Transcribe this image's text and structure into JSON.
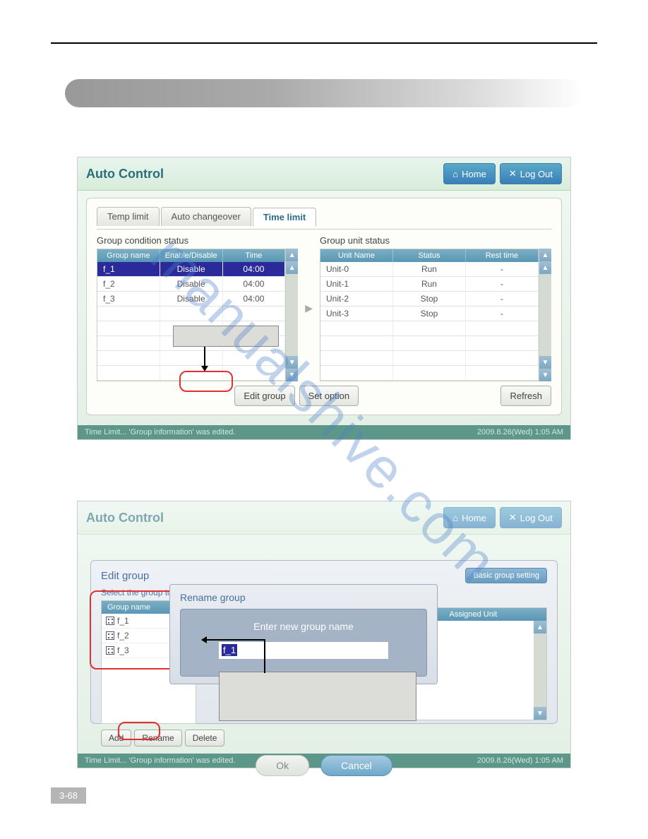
{
  "page_number": "3-68",
  "watermark": "manualshive.com",
  "app1": {
    "title": "Auto Control",
    "home": "Home",
    "logout": "Log Out",
    "tabs": {
      "temp": "Temp limit",
      "auto": "Auto changeover",
      "time": "Time limit"
    },
    "left": {
      "title": "Group condition status",
      "headers": {
        "name": "Group name",
        "enable": "Enable/Disable",
        "time": "Time"
      },
      "rows": [
        {
          "name": "f_1",
          "enable": "Disable",
          "time": "04:00"
        },
        {
          "name": "f_2",
          "enable": "Disable",
          "time": "04:00"
        },
        {
          "name": "f_3",
          "enable": "Disable",
          "time": "04:00"
        }
      ]
    },
    "right": {
      "title": "Group unit status",
      "headers": {
        "name": "Unit Name",
        "status": "Status",
        "rest": "Rest time"
      },
      "rows": [
        {
          "name": "Unit-0",
          "status": "Run",
          "rest": "-"
        },
        {
          "name": "Unit-1",
          "status": "Run",
          "rest": "-"
        },
        {
          "name": "Unit-2",
          "status": "Stop",
          "rest": "-"
        },
        {
          "name": "Unit-3",
          "status": "Stop",
          "rest": "-"
        }
      ]
    },
    "buttons": {
      "edit": "Edit group",
      "set": "Set option",
      "refresh": "Refresh"
    },
    "status_left": "Time Limit... 'Group information' was edited.",
    "status_right": "2009.8.26(Wed)  1:05 AM"
  },
  "app2": {
    "title": "Auto Control",
    "home": "Home",
    "logout": "Log Out",
    "overlay": {
      "title": "Edit group",
      "basic": "Basic group setting",
      "subtitle": "Select the group to edit",
      "list_header": "Group name",
      "items": [
        "f_1",
        "f_2",
        "f_3"
      ],
      "field_value": "f_1",
      "assigned_header": "Assigned Unit",
      "btn_add": "Add",
      "btn_rename": "Rename",
      "btn_delete": "Delete",
      "ok": "Ok",
      "cancel": "Cancel"
    },
    "rename": {
      "title": "Rename group",
      "prompt": "Enter new group name",
      "value": "f_1"
    },
    "status_left": "Time Limit... 'Group information' was edited.",
    "status_right": "2009.8.26(Wed)  1:05 AM"
  }
}
